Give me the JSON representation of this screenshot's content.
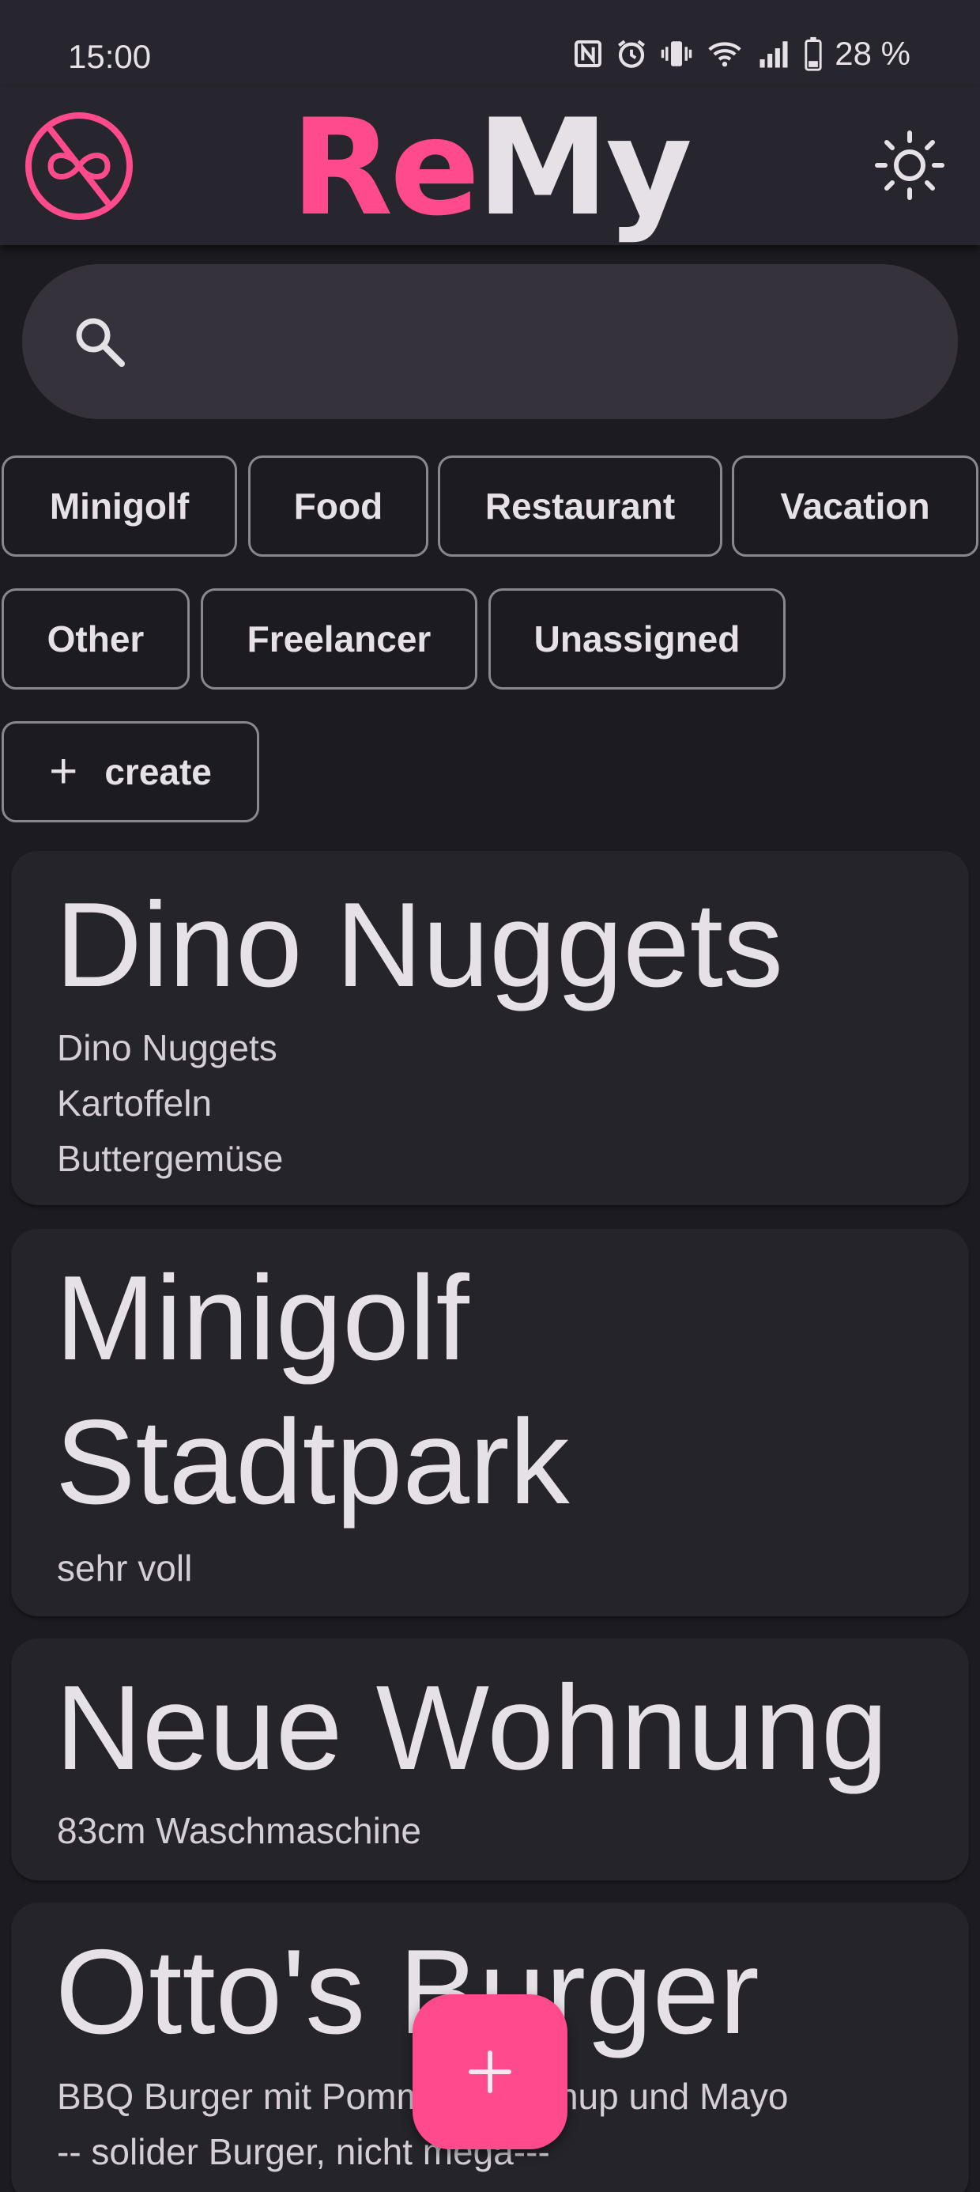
{
  "status_bar": {
    "time": "15:00",
    "battery": "28 %",
    "icons": [
      "nfc-icon",
      "alarm-icon",
      "vibrate-icon",
      "wifi-icon",
      "signal-icon",
      "battery-icon"
    ]
  },
  "app_bar": {
    "title_part1": "Re",
    "title_part2": "My",
    "logo_icon": "infinity-slash-logo-icon",
    "theme_icon": "brightness-icon"
  },
  "search": {
    "placeholder": "",
    "value": "",
    "icon": "search-icon"
  },
  "chips": [
    {
      "label": "Minigolf"
    },
    {
      "label": "Food"
    },
    {
      "label": "Restaurant"
    },
    {
      "label": "Vacation"
    },
    {
      "label": "Other"
    },
    {
      "label": "Freelancer"
    },
    {
      "label": "Unassigned"
    },
    {
      "label": "create",
      "icon": "plus-icon"
    }
  ],
  "cards": [
    {
      "title": "Dino Nuggets",
      "body": "Dino Nuggets\nKartoffeln\nButtergemüse"
    },
    {
      "title": "Minigolf\nStadtpark",
      "body": "sehr voll"
    },
    {
      "title": "Neue Wohnung",
      "body": "83cm Waschmaschine"
    },
    {
      "title": "Otto's Burger",
      "body": "BBQ Burger mit Pommes, Ketchup und Mayo\n-- solider Burger, nicht mega---"
    }
  ],
  "fab": {
    "icon": "plus-icon",
    "label": "+"
  },
  "colors": {
    "accent": "#ff4a8d",
    "background": "#1c1b21",
    "surface": "#25242b",
    "app_bar": "#27252d",
    "text": "#e6e1e6",
    "outline": "#8b8791"
  }
}
